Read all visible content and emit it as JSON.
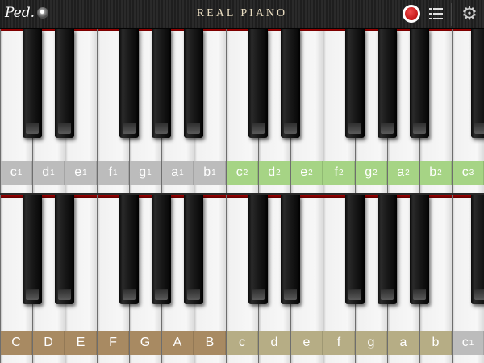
{
  "app": {
    "title": "REAL PIANO",
    "pedal_label": "Ped.",
    "settings_glyph": "⚙"
  },
  "toolbar": {
    "pedal_icon": "pedal-icon",
    "metronome_icon": "metronome-icon",
    "record_icon": "record-icon",
    "menu_icon": "list-menu-icon",
    "settings_icon": "gear-icon"
  },
  "colors": {
    "label_gray": "#bcbcbc",
    "label_green": "#a6d485",
    "label_brown": "#a88a62",
    "label_olive": "#b6ad85",
    "record_red": "#c40000"
  },
  "upper_keyboard": {
    "white_keys": [
      {
        "note": "c",
        "octave": "1",
        "color": "#bcbcbc"
      },
      {
        "note": "d",
        "octave": "1",
        "color": "#bcbcbc"
      },
      {
        "note": "e",
        "octave": "1",
        "color": "#bcbcbc"
      },
      {
        "note": "f",
        "octave": "1",
        "color": "#bcbcbc"
      },
      {
        "note": "g",
        "octave": "1",
        "color": "#bcbcbc"
      },
      {
        "note": "a",
        "octave": "1",
        "color": "#bcbcbc"
      },
      {
        "note": "b",
        "octave": "1",
        "color": "#bcbcbc"
      },
      {
        "note": "c",
        "octave": "2",
        "color": "#a6d485"
      },
      {
        "note": "d",
        "octave": "2",
        "color": "#a6d485"
      },
      {
        "note": "e",
        "octave": "2",
        "color": "#a6d485"
      },
      {
        "note": "f",
        "octave": "2",
        "color": "#a6d485"
      },
      {
        "note": "g",
        "octave": "2",
        "color": "#a6d485"
      },
      {
        "note": "a",
        "octave": "2",
        "color": "#a6d485"
      },
      {
        "note": "b",
        "octave": "2",
        "color": "#a6d485"
      },
      {
        "note": "c",
        "octave": "3",
        "color": "#a6d485"
      }
    ],
    "black_keys_after_white": [
      0,
      1,
      3,
      4,
      5,
      7,
      8,
      10,
      11,
      12,
      14
    ]
  },
  "lower_keyboard": {
    "white_keys": [
      {
        "note": "C",
        "octave": "",
        "color": "#a88a62"
      },
      {
        "note": "D",
        "octave": "",
        "color": "#a88a62"
      },
      {
        "note": "E",
        "octave": "",
        "color": "#a88a62"
      },
      {
        "note": "F",
        "octave": "",
        "color": "#a88a62"
      },
      {
        "note": "G",
        "octave": "",
        "color": "#a88a62"
      },
      {
        "note": "A",
        "octave": "",
        "color": "#a88a62"
      },
      {
        "note": "B",
        "octave": "",
        "color": "#a88a62"
      },
      {
        "note": "c",
        "octave": "",
        "color": "#b6ad85"
      },
      {
        "note": "d",
        "octave": "",
        "color": "#b6ad85"
      },
      {
        "note": "e",
        "octave": "",
        "color": "#b6ad85"
      },
      {
        "note": "f",
        "octave": "",
        "color": "#b6ad85"
      },
      {
        "note": "g",
        "octave": "",
        "color": "#b6ad85"
      },
      {
        "note": "a",
        "octave": "",
        "color": "#b6ad85"
      },
      {
        "note": "b",
        "octave": "",
        "color": "#b6ad85"
      },
      {
        "note": "c",
        "octave": "1",
        "color": "#bcbcbc"
      }
    ],
    "black_keys_after_white": [
      0,
      1,
      3,
      4,
      5,
      7,
      8,
      10,
      11,
      12,
      14
    ]
  }
}
